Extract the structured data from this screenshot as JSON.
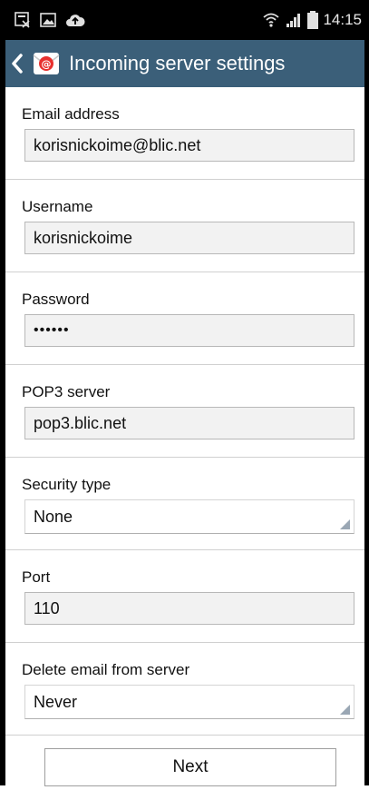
{
  "status_bar": {
    "time": "14:15",
    "icons": [
      "screenshot-icon",
      "image-icon",
      "cloud-upload-icon",
      "wifi-icon",
      "signal-icon",
      "battery-icon"
    ]
  },
  "header": {
    "title": "Incoming server settings",
    "color": "#3b5f79",
    "back_icon": "chevron-left-icon",
    "app_icon": "email-app-icon"
  },
  "form": {
    "email_label": "Email address",
    "email_value": "korisnickoime@blic.net",
    "username_label": "Username",
    "username_value": "korisnickoime",
    "password_label": "Password",
    "password_value": "••••••",
    "server_label": "POP3 server",
    "server_value": "pop3.blic.net",
    "security_label": "Security type",
    "security_value": "None",
    "port_label": "Port",
    "port_value": "110",
    "delete_label": "Delete email from server",
    "delete_value": "Never"
  },
  "actions": {
    "next_label": "Next"
  }
}
